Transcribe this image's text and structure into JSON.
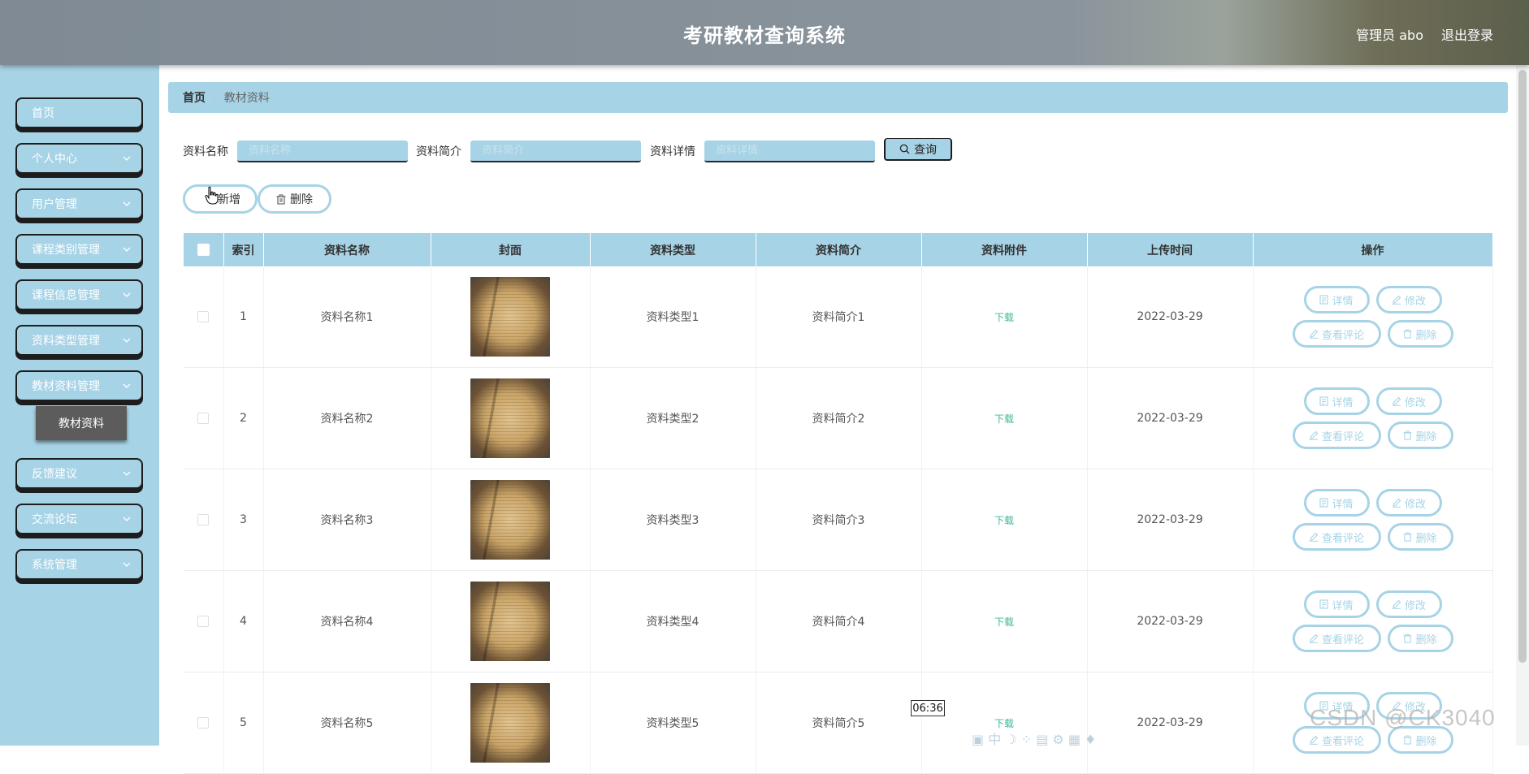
{
  "header": {
    "title": "考研教材查询系统",
    "user": "管理员 abo",
    "logout": "退出登录"
  },
  "sidebar": {
    "items": [
      {
        "label": "首页",
        "has_children": false
      },
      {
        "label": "个人中心",
        "has_children": true
      },
      {
        "label": "用户管理",
        "has_children": true
      },
      {
        "label": "课程类别管理",
        "has_children": true
      },
      {
        "label": "课程信息管理",
        "has_children": true
      },
      {
        "label": "资料类型管理",
        "has_children": true
      },
      {
        "label": "教材资料管理",
        "has_children": true
      },
      {
        "label": "反馈建议",
        "has_children": true
      },
      {
        "label": "交流论坛",
        "has_children": true
      },
      {
        "label": "系统管理",
        "has_children": true
      }
    ],
    "active_submenu": "教材资料"
  },
  "breadcrumb": {
    "home": "首页",
    "current": "教材资料"
  },
  "search": {
    "name_label": "资料名称",
    "name_placeholder": "资料名称",
    "intro_label": "资料简介",
    "intro_placeholder": "资料简介",
    "detail_label": "资料详情",
    "detail_placeholder": "资料详情",
    "query_button": "查询"
  },
  "actions": {
    "add": "新增",
    "delete": "删除"
  },
  "table": {
    "columns": [
      "索引",
      "资料名称",
      "封面",
      "资料类型",
      "资料简介",
      "资料附件",
      "上传时间",
      "操作"
    ],
    "rows": [
      {
        "index": "1",
        "name": "资料名称1",
        "type": "资料类型1",
        "intro": "资料简介1",
        "attachment": "下载",
        "time": "2022-03-29"
      },
      {
        "index": "2",
        "name": "资料名称2",
        "type": "资料类型2",
        "intro": "资料简介2",
        "attachment": "下载",
        "time": "2022-03-29"
      },
      {
        "index": "3",
        "name": "资料名称3",
        "type": "资料类型3",
        "intro": "资料简介3",
        "attachment": "下载",
        "time": "2022-03-29"
      },
      {
        "index": "4",
        "name": "资料名称4",
        "type": "资料类型4",
        "intro": "资料简介4",
        "attachment": "下载",
        "time": "2022-03-29"
      },
      {
        "index": "5",
        "name": "资料名称5",
        "type": "资料类型5",
        "intro": "资料简介5",
        "attachment": "下载",
        "time": "2022-03-29"
      }
    ],
    "row_actions": {
      "detail": "详情",
      "edit": "修改",
      "comments": "查看评论",
      "delete": "删除"
    }
  },
  "overlay": {
    "time_tooltip": "06:36",
    "watermark": "CSDN @CK3040"
  },
  "colors": {
    "accent": "#a7d3e6",
    "header": "#8a949c",
    "download_link": "#3fb598",
    "submenu_active": "#5c5c5c"
  }
}
